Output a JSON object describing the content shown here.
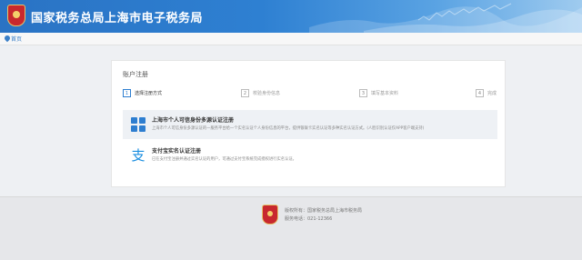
{
  "header": {
    "title": "国家税务总局上海市电子税务局",
    "emblem_icon": "tax-emblem-icon",
    "brand_color": "#2e7ed0"
  },
  "breadcrumb": {
    "icon": "location-pin-icon",
    "home": "首页"
  },
  "card": {
    "title": "账户注册",
    "steps": [
      {
        "number": "1",
        "label": "选择注册方式",
        "active": true
      },
      {
        "number": "2",
        "label": "校验身份信息",
        "active": false
      },
      {
        "number": "3",
        "label": "填写基本资料",
        "active": false
      },
      {
        "number": "4",
        "label": "完成",
        "active": false
      }
    ],
    "options": [
      {
        "icon": "grid-icon",
        "title": "上海市个人可信身份多源认证注册",
        "description": "上海市个人可信身份多源认证的一服务平台给一个实名认证个人身份信息的平台，提供银联卡实名认证等多种实名认证方式。(人脸识别认证仅APP客户端支持)"
      },
      {
        "icon": "alipay-icon",
        "title": "支付宝实名认证注册",
        "description": "已在支付宝注册并通过实名认证的用户，可通过支付宝系统完成授权进行实名认证。"
      }
    ]
  },
  "footer": {
    "icon": "tax-emblem-icon",
    "copyright": "版权所有：国家税务总局上海市税务局",
    "hotline": "服务电话：021-12366"
  }
}
